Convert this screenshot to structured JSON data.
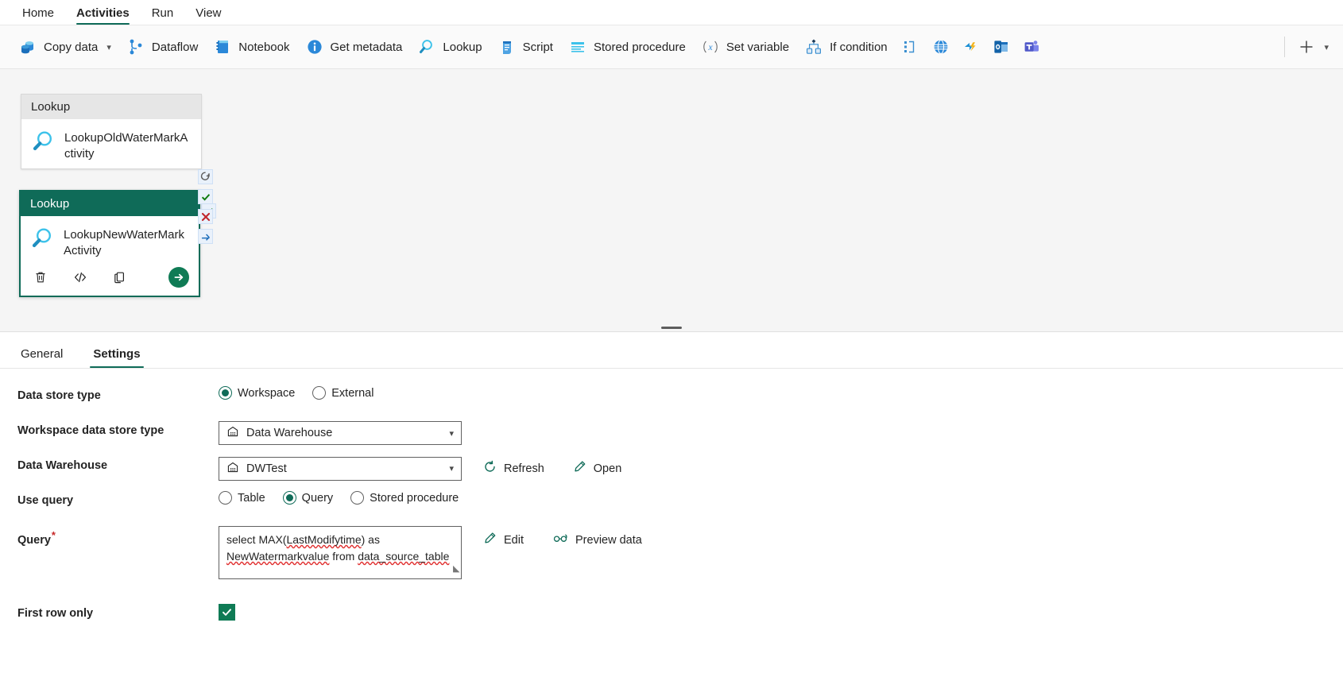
{
  "ribbon": {
    "tabs": [
      {
        "label": "Home",
        "active": false
      },
      {
        "label": "Activities",
        "active": true
      },
      {
        "label": "Run",
        "active": false
      },
      {
        "label": "View",
        "active": false
      }
    ]
  },
  "command_bar": {
    "items": [
      {
        "label": "Copy data",
        "icon": "copy-data-icon",
        "has_chevron": true
      },
      {
        "label": "Dataflow",
        "icon": "dataflow-icon",
        "has_chevron": false
      },
      {
        "label": "Notebook",
        "icon": "notebook-icon",
        "has_chevron": false
      },
      {
        "label": "Get metadata",
        "icon": "info-icon",
        "has_chevron": false
      },
      {
        "label": "Lookup",
        "icon": "magnifier-icon",
        "has_chevron": false
      },
      {
        "label": "Script",
        "icon": "script-scroll-icon",
        "has_chevron": false
      },
      {
        "label": "Stored procedure",
        "icon": "stored-procedure-icon",
        "has_chevron": false
      },
      {
        "label": "Set variable",
        "icon": "set-variable-x-icon",
        "has_chevron": false
      },
      {
        "label": "If condition",
        "icon": "if-condition-icon",
        "has_chevron": false
      }
    ],
    "icon_only": [
      {
        "icon": "switch-case-icon"
      },
      {
        "icon": "web-globe-icon"
      },
      {
        "icon": "azure-function-icon"
      },
      {
        "icon": "outlook-icon"
      },
      {
        "icon": "teams-icon"
      }
    ],
    "add_label": "+",
    "add_chevron": "⌄"
  },
  "canvas": {
    "nodes": [
      {
        "type_label": "Lookup",
        "name": "LookupOldWaterMarkActivity",
        "icon": "magnifier-icon",
        "selected": false,
        "statuses": [
          "success-check-icon"
        ]
      },
      {
        "type_label": "Lookup",
        "name": "LookupNewWaterMarkActivity",
        "icon": "magnifier-icon",
        "selected": true,
        "statuses": [
          "retry-arrow-icon",
          "success-check-icon",
          "failure-x-icon",
          "skip-arrow-icon"
        ],
        "actions": [
          "delete-icon",
          "code-view-icon",
          "clone-icon"
        ],
        "run_action": "run-arrow-icon"
      }
    ]
  },
  "properties": {
    "tabs": [
      {
        "label": "General",
        "active": false
      },
      {
        "label": "Settings",
        "active": true
      }
    ],
    "fields": {
      "data_store_type": {
        "label": "Data store type",
        "options": [
          {
            "label": "Workspace",
            "selected": true
          },
          {
            "label": "External",
            "selected": false
          }
        ]
      },
      "workspace_data_store_type": {
        "label": "Workspace data store type",
        "value": "Data Warehouse",
        "icon": "warehouse-icon",
        "chevron": "⌄"
      },
      "data_warehouse": {
        "label": "Data Warehouse",
        "value": "DWTest",
        "icon": "warehouse-icon",
        "chevron": "⌄",
        "actions": [
          {
            "label": "Refresh",
            "icon": "refresh-icon"
          },
          {
            "label": "Open",
            "icon": "pencil-icon"
          }
        ]
      },
      "use_query": {
        "label": "Use query",
        "options": [
          {
            "label": "Table",
            "selected": false
          },
          {
            "label": "Query",
            "selected": true
          },
          {
            "label": "Stored procedure",
            "selected": false
          }
        ]
      },
      "query": {
        "label": "Query",
        "required_marker": "*",
        "value": "select MAX(LastModifytime) as NewWatermarkvalue from data_source_table",
        "tokens": [
          {
            "text": "select MAX(",
            "spell_error": false
          },
          {
            "text": "LastModifytime",
            "spell_error": true
          },
          {
            "text": ") as ",
            "spell_error": false
          },
          {
            "text": "NewWatermarkvalue",
            "spell_error": true
          },
          {
            "text": " from ",
            "spell_error": false
          },
          {
            "text": "data_source_table",
            "spell_error": true
          }
        ],
        "actions": [
          {
            "label": "Edit",
            "icon": "pencil-icon"
          },
          {
            "label": "Preview data",
            "icon": "glasses-icon"
          }
        ]
      },
      "first_row_only": {
        "label": "First row only",
        "checked": true
      }
    }
  },
  "colors": {
    "accent_green": "#0f6b58",
    "node_selected_header": "#0f6b58",
    "checkbox_green": "#0f7b55",
    "required_red": "#c62828",
    "canvas_bg": "#f5f5f5"
  }
}
